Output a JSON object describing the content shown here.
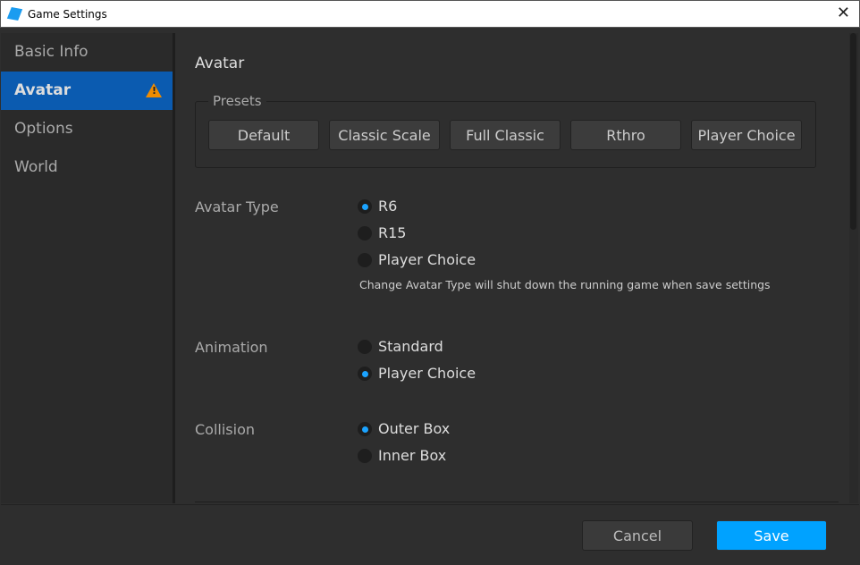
{
  "window": {
    "title": "Game Settings"
  },
  "sidebar": {
    "items": [
      {
        "label": "Basic Info"
      },
      {
        "label": "Avatar"
      },
      {
        "label": "Options"
      },
      {
        "label": "World"
      }
    ]
  },
  "main": {
    "heading": "Avatar",
    "presets": {
      "label": "Presets",
      "buttons": [
        "Default",
        "Classic Scale",
        "Full Classic",
        "Rthro",
        "Player Choice"
      ]
    },
    "avatar_type": {
      "label": "Avatar Type",
      "options": [
        "R6",
        "R15",
        "Player Choice"
      ],
      "selected": "R6",
      "note": "Change Avatar Type will shut down the running game when save settings"
    },
    "animation": {
      "label": "Animation",
      "options": [
        "Standard",
        "Player Choice"
      ],
      "selected": "Player Choice"
    },
    "collision": {
      "label": "Collision",
      "options": [
        "Outer Box",
        "Inner Box"
      ],
      "selected": "Outer Box"
    }
  },
  "footer": {
    "cancel": "Cancel",
    "save": "Save"
  },
  "colors": {
    "accent": "#00a2ff",
    "selected_nav": "#0b5bb0",
    "warning": "#f08c00"
  }
}
